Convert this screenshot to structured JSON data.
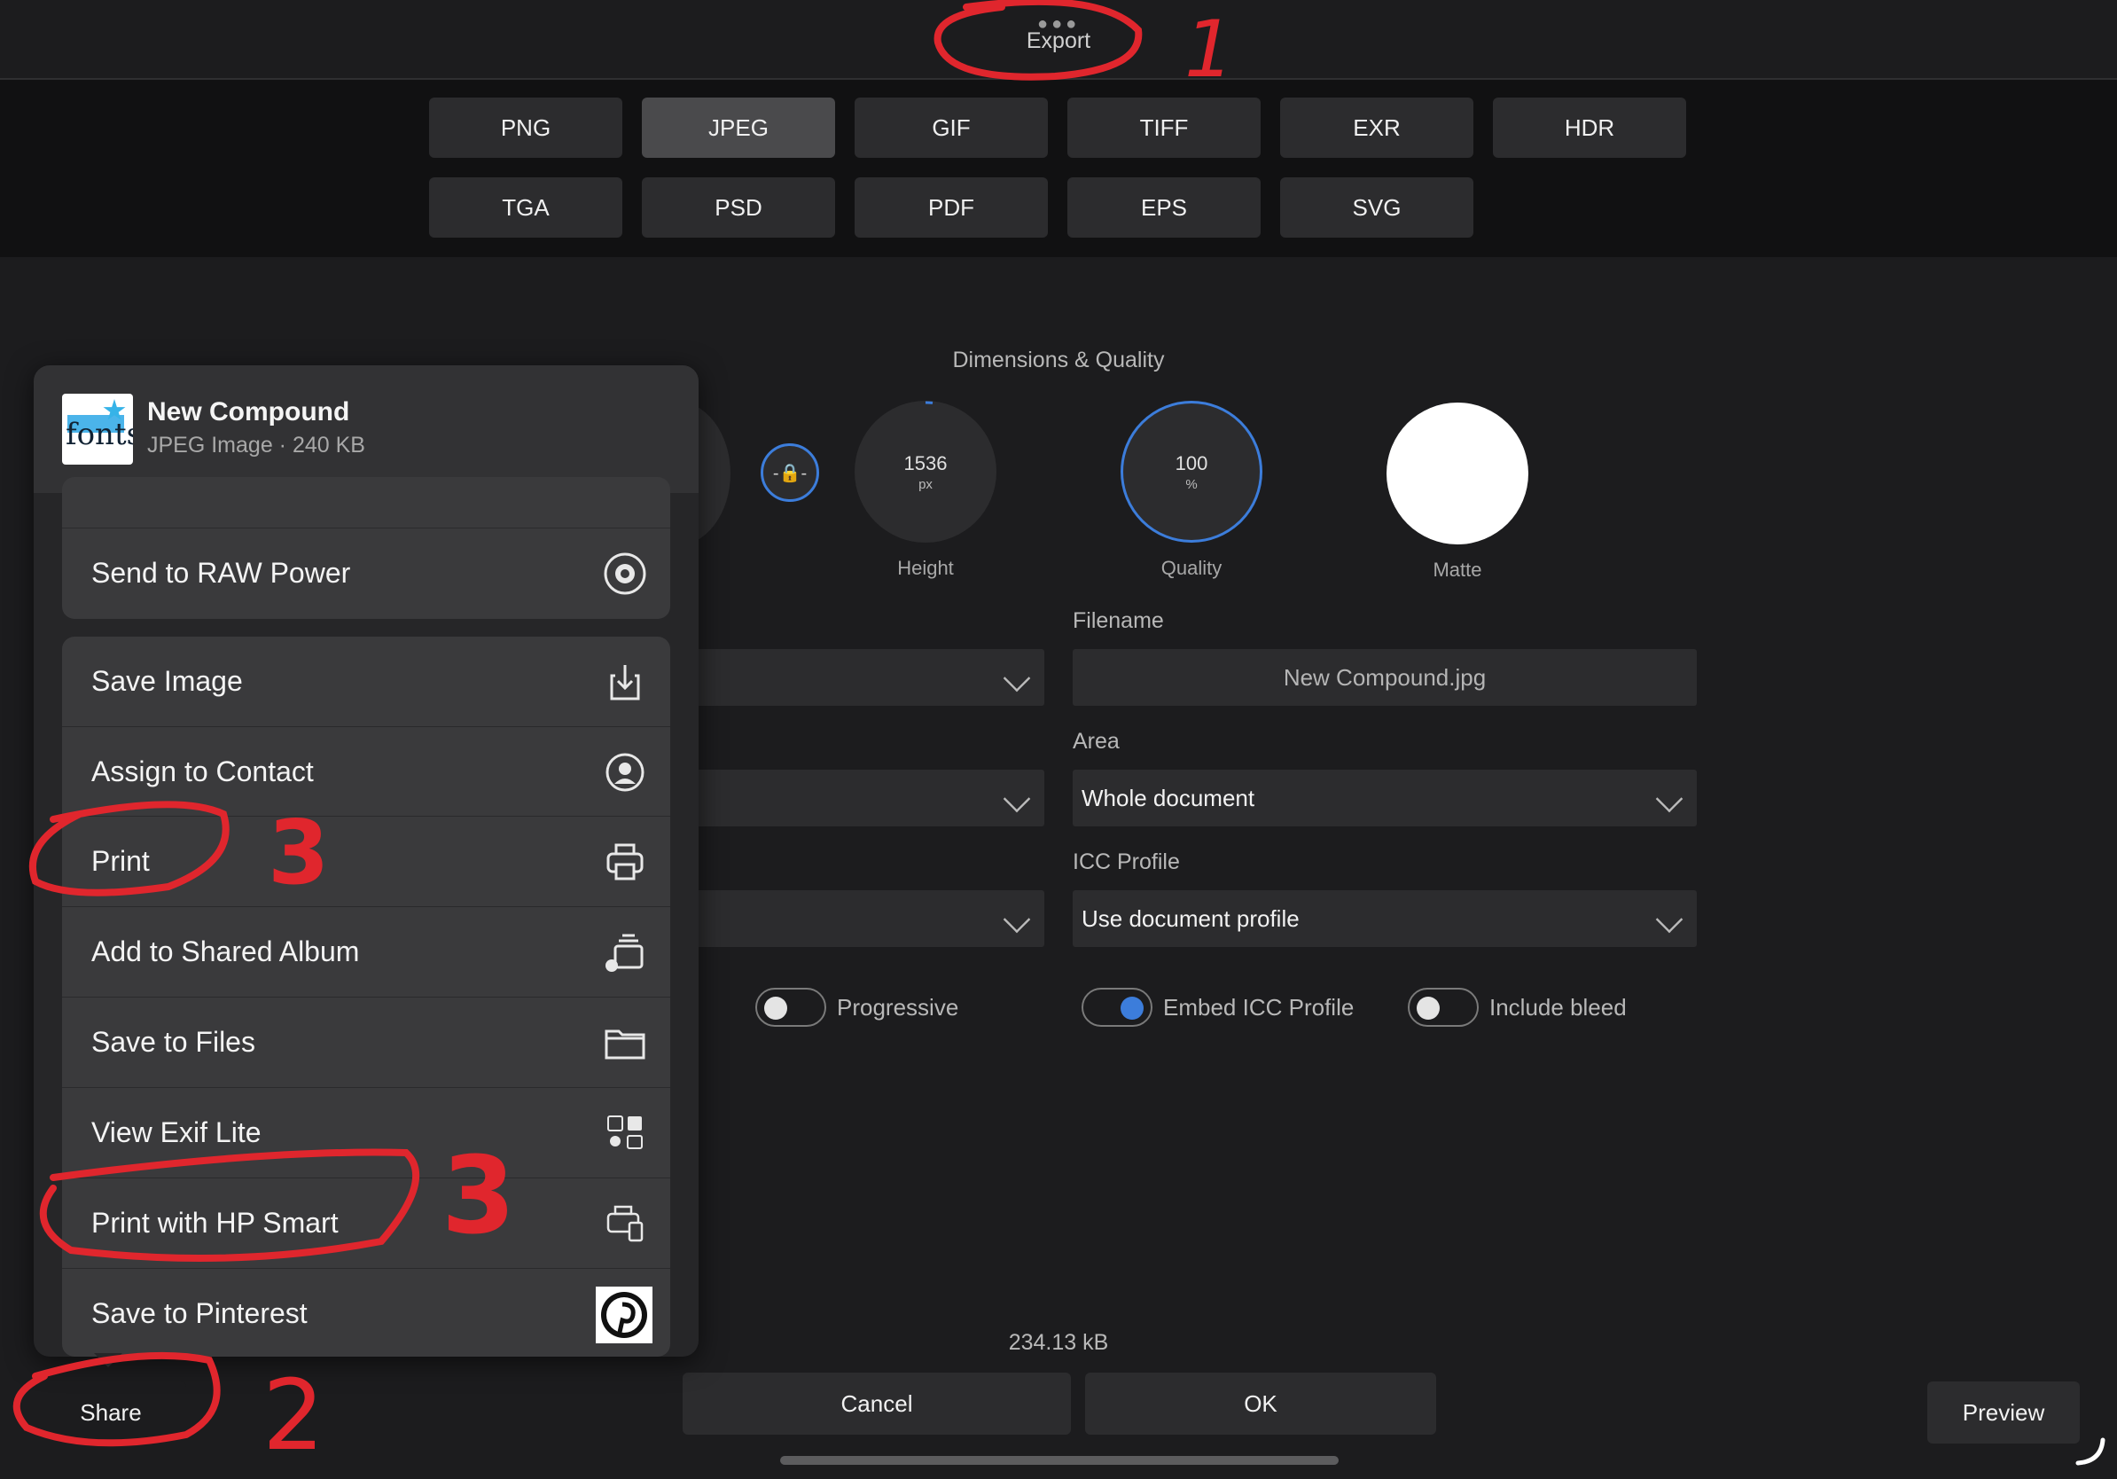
{
  "header": {
    "title": "Export"
  },
  "formats": [
    "PNG",
    "JPEG",
    "GIF",
    "TIFF",
    "EXR",
    "HDR",
    "TGA",
    "PSD",
    "PDF",
    "EPS",
    "SVG"
  ],
  "selected_format": "JPEG",
  "dimensions": {
    "section_title": "Dimensions & Quality",
    "height_value": "1536",
    "height_unit": "px",
    "height_label": "Height",
    "quality_value": "100",
    "quality_unit": "%",
    "quality_label": "Quality",
    "matte_label": "Matte"
  },
  "fields": {
    "filename_label": "Filename",
    "filename_value": "New Compound.jpg",
    "area_label": "Area",
    "area_value": "Whole document",
    "icc_label": "ICC Profile",
    "icc_value": "Use document profile"
  },
  "toggles": {
    "progressive": {
      "label": "Progressive",
      "on": false
    },
    "embed_icc": {
      "label": "Embed ICC Profile",
      "on": true
    },
    "include_bleed": {
      "label": "Include bleed",
      "on": false
    }
  },
  "file_size": "234.13 kB",
  "buttons": {
    "cancel": "Cancel",
    "ok": "OK",
    "preview": "Preview",
    "share": "Share"
  },
  "share_sheet": {
    "doc_name": "New Compound",
    "doc_sub": "JPEG Image · 240 KB",
    "thumb_text": "fonts",
    "raw_power": "Send to RAW Power",
    "actions": [
      "Save Image",
      "Assign to Contact",
      "Print",
      "Add to Shared Album",
      "Save to Files",
      "View Exif Lite",
      "Print with HP Smart",
      "Save to Pinterest"
    ],
    "icons": [
      "download-icon",
      "contact-icon",
      "printer-icon",
      "shared-album-icon",
      "folder-icon",
      "exif-icon",
      "hp-smart-icon",
      "pinterest-icon"
    ]
  },
  "annotations": {
    "n1": "1",
    "n2": "2",
    "n3a": "3",
    "n3b": "3"
  },
  "colors": {
    "accent": "#3c7ddb",
    "annotation": "#e0262d",
    "background": "#1c1c1e",
    "surface": "#2c2c2e"
  }
}
